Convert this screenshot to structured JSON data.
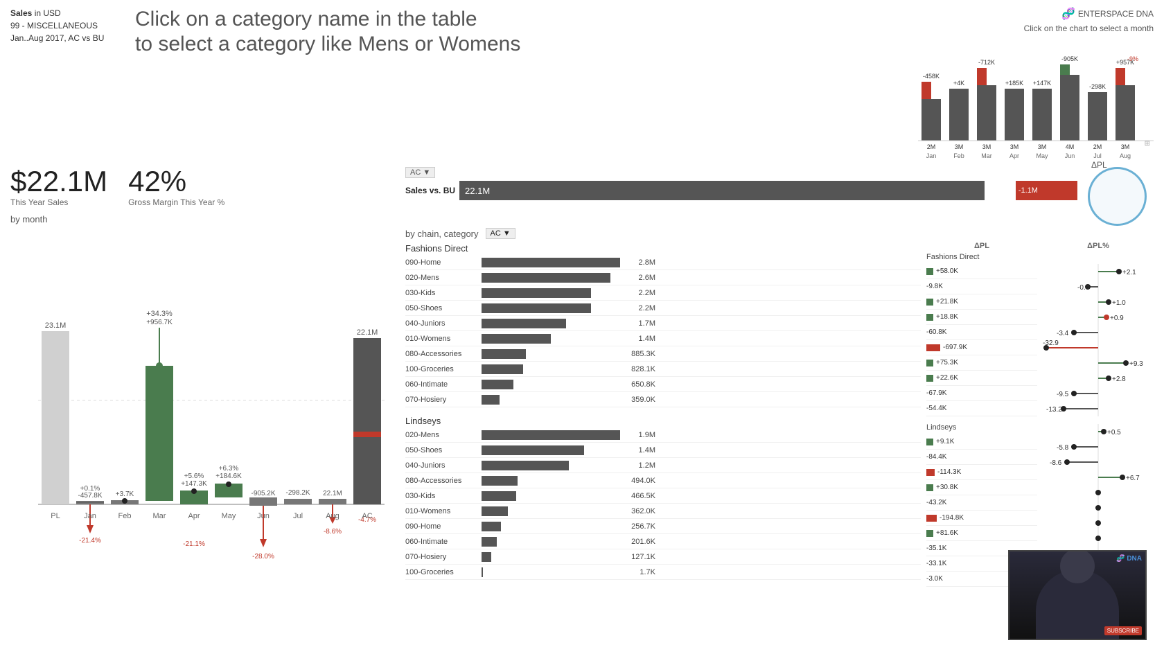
{
  "header": {
    "sales_label": "Sales",
    "sales_unit": "in USD",
    "misc_code": "99 - MISCELLANEOUS",
    "period": "Jan..Aug 2017, AC vs BU",
    "title_line1": "Click on a category name in the table",
    "title_line2": "to select a category like Mens or Womens",
    "top_right_instruction": "Click on the chart to select a month",
    "dna_logo": "ENTERSPACE DNA"
  },
  "kpis": {
    "sales_value": "$22.1M",
    "sales_label": "This Year Sales",
    "gm_value": "42%",
    "gm_label": "Gross Margin This Year %"
  },
  "by_month_label": "by month",
  "sales_vs_bu": {
    "label": "Sales vs. BU",
    "ac_label": "AC",
    "main_value": "22.1M",
    "delta_value": "-1.1M",
    "apl_label": "ΔPL"
  },
  "by_chain_label": "by chain, category",
  "ac_dropdown": "AC ▼",
  "col_headers": {
    "apl": "ΔPL",
    "apl_pct": "ΔPL%"
  },
  "fashions_direct": {
    "name": "Fashions Direct",
    "rows": [
      {
        "name": "090-Home",
        "bar_pct": 100,
        "value": "2.8M",
        "dpl": "+58.0K",
        "dpl_pct": "+2.1",
        "dpl_type": "pos",
        "dpl_pct_type": "pos"
      },
      {
        "name": "020-Mens",
        "bar_pct": 93,
        "value": "2.6M",
        "dpl": "-9.8K",
        "dpl_pct": "-0.4",
        "dpl_type": "neg",
        "dpl_pct_type": "neg"
      },
      {
        "name": "030-Kids",
        "bar_pct": 79,
        "value": "2.2M",
        "dpl": "+21.8K",
        "dpl_pct": "+1.0",
        "dpl_type": "pos",
        "dpl_pct_type": "pos"
      },
      {
        "name": "050-Shoes",
        "bar_pct": 79,
        "value": "2.2M",
        "dpl": "+18.8K",
        "dpl_pct": "+0.9",
        "dpl_type": "pos",
        "dpl_pct_type": "pos"
      },
      {
        "name": "040-Juniors",
        "bar_pct": 61,
        "value": "1.7M",
        "dpl": "-60.8K",
        "dpl_pct": "-3.4",
        "dpl_type": "neg",
        "dpl_pct_type": "neg"
      },
      {
        "name": "010-Womens",
        "bar_pct": 50,
        "value": "1.4M",
        "dpl": "-697.9K",
        "dpl_pct": "-32.9",
        "dpl_type": "neg_large",
        "dpl_pct_type": "neg_large"
      },
      {
        "name": "080-Accessories",
        "bar_pct": 32,
        "value": "885.3K",
        "dpl": "+75.3K",
        "dpl_pct": "+9.3",
        "dpl_type": "pos",
        "dpl_pct_type": "pos"
      },
      {
        "name": "100-Groceries",
        "bar_pct": 30,
        "value": "828.1K",
        "dpl": "+22.6K",
        "dpl_pct": "+2.8",
        "dpl_type": "pos",
        "dpl_pct_type": "pos"
      },
      {
        "name": "060-Intimate",
        "bar_pct": 23,
        "value": "650.8K",
        "dpl": "-67.9K",
        "dpl_pct": "-9.5",
        "dpl_type": "neg",
        "dpl_pct_type": "neg"
      },
      {
        "name": "070-Hosiery",
        "bar_pct": 13,
        "value": "359.0K",
        "dpl": "-54.4K",
        "dpl_pct": "-13.2",
        "dpl_type": "neg",
        "dpl_pct_type": "neg"
      }
    ]
  },
  "lindseys": {
    "name": "Lindseys",
    "rows": [
      {
        "name": "020-Mens",
        "bar_pct": 100,
        "value": "1.9M",
        "dpl": "+9.1K",
        "dpl_pct": "+0.5",
        "dpl_type": "pos",
        "dpl_pct_type": "pos"
      },
      {
        "name": "050-Shoes",
        "bar_pct": 74,
        "value": "1.4M",
        "dpl": "-84.4K",
        "dpl_pct": "-5.8",
        "dpl_type": "neg",
        "dpl_pct_type": "neg"
      },
      {
        "name": "040-Juniors",
        "bar_pct": 63,
        "value": "1.2M",
        "dpl": "-114.3K",
        "dpl_pct": "-8.6",
        "dpl_type": "neg",
        "dpl_pct_type": "neg"
      },
      {
        "name": "080-Accessories",
        "bar_pct": 26,
        "value": "494.0K",
        "dpl": "+30.8K",
        "dpl_pct": "+6.7",
        "dpl_type": "pos",
        "dpl_pct_type": "pos"
      },
      {
        "name": "030-Kids",
        "bar_pct": 25,
        "value": "466.5K",
        "dpl": "-43.2K",
        "dpl_pct": "",
        "dpl_type": "neg",
        "dpl_pct_type": "neg"
      },
      {
        "name": "010-Womens",
        "bar_pct": 19,
        "value": "362.0K",
        "dpl": "-194.8K",
        "dpl_pct": "",
        "dpl_type": "neg_large",
        "dpl_pct_type": "neg"
      },
      {
        "name": "090-Home",
        "bar_pct": 14,
        "value": "256.7K",
        "dpl": "+81.6K",
        "dpl_pct": "",
        "dpl_type": "pos",
        "dpl_pct_type": "pos"
      },
      {
        "name": "060-Intimate",
        "bar_pct": 11,
        "value": "201.6K",
        "dpl": "-35.1K",
        "dpl_pct": "",
        "dpl_type": "neg",
        "dpl_pct_type": "neg"
      },
      {
        "name": "070-Hosiery",
        "bar_pct": 7,
        "value": "127.1K",
        "dpl": "-33.1K",
        "dpl_pct": "",
        "dpl_type": "neg",
        "dpl_pct_type": "neg"
      },
      {
        "name": "100-Groceries",
        "bar_pct": 0.1,
        "value": "1.7K",
        "dpl": "-3.0K",
        "dpl_pct": "",
        "dpl_type": "neg",
        "dpl_pct_type": "neg"
      }
    ]
  },
  "waterfall": {
    "months": [
      "PL",
      "Jan",
      "Feb",
      "Mar",
      "Apr",
      "May",
      "Jun",
      "Jul",
      "Aug",
      "AC"
    ],
    "values": [
      "23.1M",
      "",
      "",
      "",
      "",
      "",
      "",
      "",
      "22.1M",
      "22.1M"
    ],
    "deltas": [
      "",
      "-457.8K",
      "+3.7K",
      "+956.7K",
      "+147.3K",
      "+184.6K",
      "-905.2K",
      "-298.2K",
      "",
      "-4.7%"
    ],
    "above_labels": [
      "",
      "+0.1%",
      "",
      "+34.3%",
      "+5.6%",
      "+6.3%",
      "",
      "",
      "",
      ""
    ],
    "below_labels": [
      "",
      "",
      "",
      "",
      "",
      "",
      "-28.0%",
      "",
      "-8.6%",
      ""
    ],
    "variance_labels": [
      "",
      "-21.4%",
      "",
      "",
      "-21.1%",
      "",
      "",
      "",
      "",
      ""
    ]
  },
  "monthly_chart": {
    "months": [
      "Jan",
      "Feb",
      "Mar",
      "Apr",
      "May",
      "Jun",
      "Jul",
      "Aug"
    ],
    "top_labels": [
      "-458K",
      "+4K",
      "-712K",
      "+185K",
      "+147K",
      "-905K",
      "-298K",
      "+957K"
    ],
    "bottom_labels": [
      "2M",
      "3M",
      "3M",
      "3M",
      "3M",
      "4M",
      "2M",
      "3M"
    ],
    "red_labels": [
      "-9%"
    ],
    "bars": [
      {
        "dark": 60,
        "green": 0,
        "red": 15
      },
      {
        "dark": 65,
        "green": 0,
        "red": 0
      },
      {
        "dark": 70,
        "green": 0,
        "red": 20
      },
      {
        "dark": 55,
        "green": 0,
        "red": 0
      },
      {
        "dark": 58,
        "green": 0,
        "red": 0
      },
      {
        "dark": 75,
        "green": 12,
        "red": 0
      },
      {
        "dark": 50,
        "green": 0,
        "red": 0
      },
      {
        "dark": 62,
        "green": 0,
        "red": 25
      }
    ]
  }
}
